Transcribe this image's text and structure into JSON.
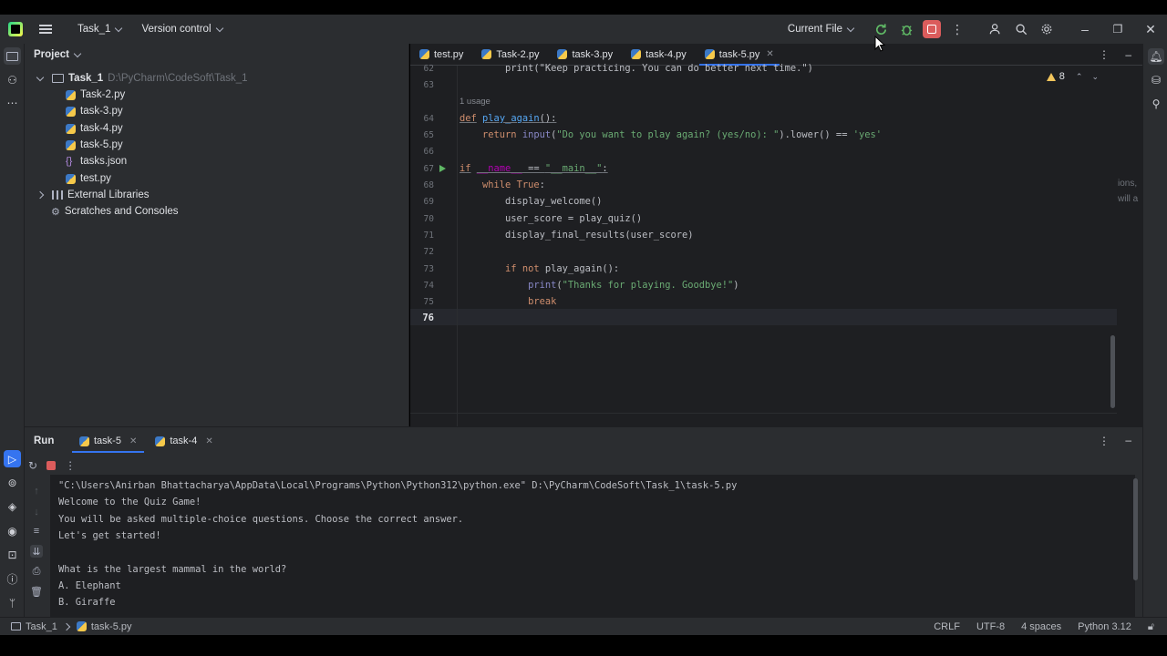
{
  "toolbar": {
    "project_name": "Task_1",
    "vcs": "Version control",
    "run_config": "Current File"
  },
  "project_panel": {
    "title": "Project",
    "root": {
      "name": "Task_1",
      "path": "D:\\PyCharm\\CodeSoft\\Task_1"
    },
    "files": [
      "Task-2.py",
      "task-3.py",
      "task-4.py",
      "task-5.py",
      "tasks.json",
      "test.py"
    ],
    "external_libraries": "External Libraries",
    "scratches": "Scratches and Consoles"
  },
  "editor": {
    "tabs": [
      "test.py",
      "Task-2.py",
      "task-3.py",
      "task-4.py",
      "task-5.py"
    ],
    "active_tab": "task-5.py",
    "warnings": "8",
    "usage_hint": "1 usage",
    "lines": [
      {
        "n": "62",
        "text": "        print(\"Keep practicing. You can do better next time.\")"
      },
      {
        "n": "63",
        "text": ""
      },
      {
        "n": "64",
        "text": "def play_again():"
      },
      {
        "n": "65",
        "text": "    return input(\"Do you want to play again? (yes/no): \").lower() == 'yes'"
      },
      {
        "n": "66",
        "text": ""
      },
      {
        "n": "67",
        "text": "if __name__ == \"__main__\":"
      },
      {
        "n": "68",
        "text": "    while True:"
      },
      {
        "n": "69",
        "text": "        display_welcome()"
      },
      {
        "n": "70",
        "text": "        user_score = play_quiz()"
      },
      {
        "n": "71",
        "text": "        display_final_results(user_score)"
      },
      {
        "n": "72",
        "text": ""
      },
      {
        "n": "73",
        "text": "        if not play_again():"
      },
      {
        "n": "74",
        "text": "            print(\"Thanks for playing. Goodbye!\")"
      },
      {
        "n": "75",
        "text": "            break"
      },
      {
        "n": "76",
        "text": ""
      }
    ],
    "ghost_text": [
      "ions,",
      "will a"
    ]
  },
  "run_panel": {
    "title": "Run",
    "tabs": [
      "task-5",
      "task-4"
    ],
    "active_tab": "task-5",
    "output": [
      "\"C:\\Users\\Anirban Bhattacharya\\AppData\\Local\\Programs\\Python\\Python312\\python.exe\" D:\\PyCharm\\CodeSoft\\Task_1\\task-5.py",
      "Welcome to the Quiz Game!",
      "You will be asked multiple-choice questions. Choose the correct answer.",
      "Let's get started!",
      "",
      "What is the largest mammal in the world?",
      "A. Elephant",
      "B. Giraffe"
    ]
  },
  "statusbar": {
    "crumb_project": "Task_1",
    "crumb_file": "task-5.py",
    "line_sep": "CRLF",
    "encoding": "UTF-8",
    "indent": "4 spaces",
    "interpreter": "Python 3.12"
  },
  "colors": {
    "accent": "#3574f0",
    "stop": "#db5c5c",
    "run_green": "#5fb865",
    "panel_bg": "#2b2d30",
    "editor_bg": "#1e1f22"
  }
}
